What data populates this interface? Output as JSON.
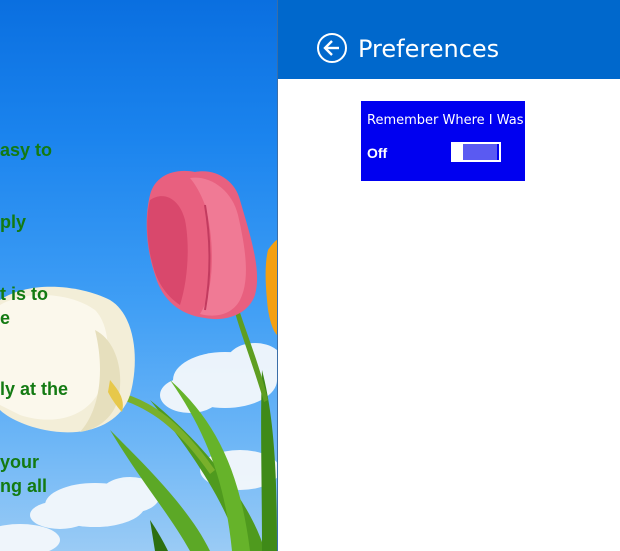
{
  "background_text": {
    "lines": [
      "asy to",
      "ply",
      "t is to",
      "e",
      "ly at the",
      "your",
      "ng all"
    ]
  },
  "preferences": {
    "title": "Preferences",
    "back_icon": "back-arrow-icon",
    "settings": [
      {
        "label": "Remember Where I Was",
        "state_text": "Off",
        "on_fraction": 0
      }
    ]
  },
  "colors": {
    "header": "#0068cc",
    "setting_card": "#0000f0",
    "left_text": "#137a12"
  }
}
